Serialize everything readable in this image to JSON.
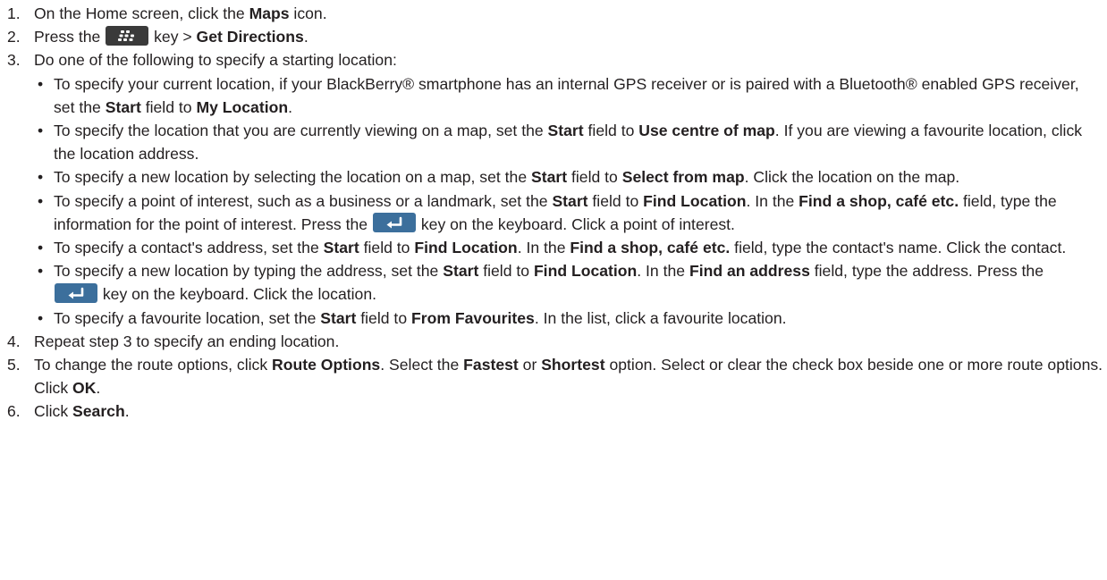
{
  "icons": {
    "menu_key": "blackberry-menu-key-icon",
    "enter_key": "enter-key-icon"
  },
  "colors": {
    "text": "#231f20",
    "menu_key": "#3a3a3a",
    "enter_key": "#3c6f9c"
  },
  "steps": [
    {
      "num": "1.",
      "a": "On the Home screen, click the ",
      "b1": "Maps",
      "c": " icon."
    },
    {
      "num": "2.",
      "a": "Press the ",
      "b": " key > ",
      "b1": "Get Directions",
      "c": "."
    },
    {
      "num": "3.",
      "text": "Do one of the following to specify a starting location:"
    },
    {
      "num": "4.",
      "text": "Repeat step 3 to specify an ending location."
    },
    {
      "num": "5.",
      "a": "To change the route options, click ",
      "b1": "Route Options",
      "c": ". Select the ",
      "b2": "Fastest",
      "d": " or ",
      "b3": "Shortest",
      "e": " option. Select or clear the check box beside one or more route options. Click ",
      "b4": "OK",
      "f": "."
    },
    {
      "num": "6.",
      "a": "Click ",
      "b1": "Search",
      "c": "."
    }
  ],
  "bullets": [
    {
      "mark": "•",
      "a": "To specify your current location, if your BlackBerry® smartphone has an internal GPS receiver or is paired with a Bluetooth® enabled GPS receiver, set the ",
      "b1": "Start",
      "c": " field to ",
      "b2": "My Location",
      "d": "."
    },
    {
      "mark": "•",
      "a": "To specify the location that you are currently viewing on a map, set the ",
      "b1": "Start",
      "c": " field to ",
      "b2": "Use centre of map",
      "d": ". If you are viewing a favourite location, click the location address."
    },
    {
      "mark": "•",
      "a": "To specify a new location by selecting the location on a map, set the ",
      "b1": "Start",
      "c": " field to ",
      "b2": "Select from map",
      "d": ". Click the location on the map."
    },
    {
      "mark": "•",
      "a": "To specify a point of interest, such as a business or a landmark, set the ",
      "b1": "Start",
      "c": " field to ",
      "b2": "Find Location",
      "d": ". In the ",
      "b3": "Find a shop, café etc.",
      "e": " field, type the information for the point of interest. Press the ",
      "f": " key on the keyboard. Click a point of interest."
    },
    {
      "mark": "•",
      "a": "To specify a contact's address, set the ",
      "b1": "Start",
      "c": " field to ",
      "b2": "Find Location",
      "d": ". In the ",
      "b3": "Find a shop, café etc.",
      "e": " field, type the contact's name. Click the contact."
    },
    {
      "mark": "•",
      "a": "To specify a new location by typing the address, set the ",
      "b1": "Start",
      "c": " field to ",
      "b2": "Find Location",
      "d": ". In the ",
      "b3": "Find an address",
      "e": " field, type the address. Press the ",
      "f": " key on the keyboard. Click the location."
    },
    {
      "mark": "•",
      "a": "To specify a favourite location, set the ",
      "b1": "Start",
      "c": " field to ",
      "b2": "From Favourites",
      "d": ". In the list, click a favourite location."
    }
  ]
}
